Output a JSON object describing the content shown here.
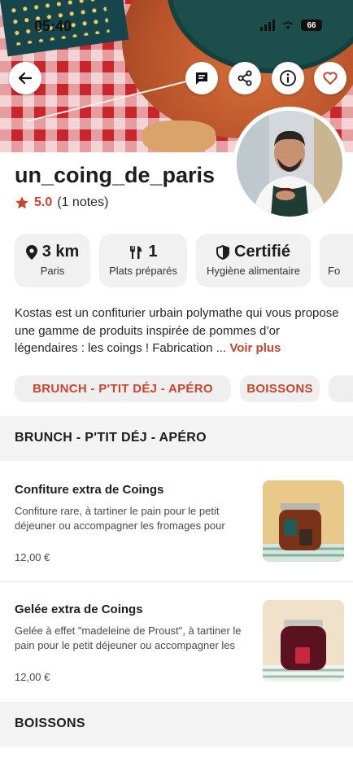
{
  "status_bar": {
    "time": "05:40",
    "battery": "66"
  },
  "header": {
    "actions": [
      {
        "name": "back",
        "icon": "arrow-left-icon"
      },
      {
        "name": "message",
        "icon": "message-icon"
      },
      {
        "name": "share",
        "icon": "share-icon"
      },
      {
        "name": "info",
        "icon": "info-icon"
      },
      {
        "name": "favorite",
        "icon": "heart-icon"
      }
    ]
  },
  "profile": {
    "name": "un_coing_de_paris",
    "rating": "5.0",
    "rating_count": "(1 notes)",
    "stats": [
      {
        "icon": "location-pin-icon",
        "value": "3 km",
        "label": "Paris"
      },
      {
        "icon": "fork-knife-icon",
        "value": "1",
        "label": "Plats préparés"
      },
      {
        "icon": "shield-check-icon",
        "value": "Certifié",
        "label": "Hygiène alimentaire"
      },
      {
        "icon": "",
        "value": "",
        "label": "Fo"
      }
    ],
    "description": "Kostas est un confiturier urbain polymathe qui vous propose une gamme de produits inspirée de pommes d’or légendaires : les coings ! Fabrication ...",
    "see_more": "Voir plus"
  },
  "categories": [
    "BRUNCH - P'TIT DÉJ - APÉRO",
    "BOISSONS"
  ],
  "sections": [
    {
      "title": "BRUNCH - P'TIT DÉJ - APÉRO",
      "products": [
        {
          "name": "Confiture extra de Coings",
          "description": "Confiture rare, à tartiner le pain pour le petit déjeuner ou accompagner les fromages pour",
          "price": "12,00 €"
        },
        {
          "name": "Gelée extra de Coings",
          "description": "Gelée à effet \"madeleine de Proust\", à tartiner le pain pour le petit déjeuner ou accompagner les",
          "price": "12,00 €"
        }
      ]
    },
    {
      "title": "BOISSONS",
      "products": []
    }
  ],
  "colors": {
    "accent": "#c7472e",
    "chip_bg": "#f1f1f1",
    "section_bg": "#f3f3f3"
  }
}
